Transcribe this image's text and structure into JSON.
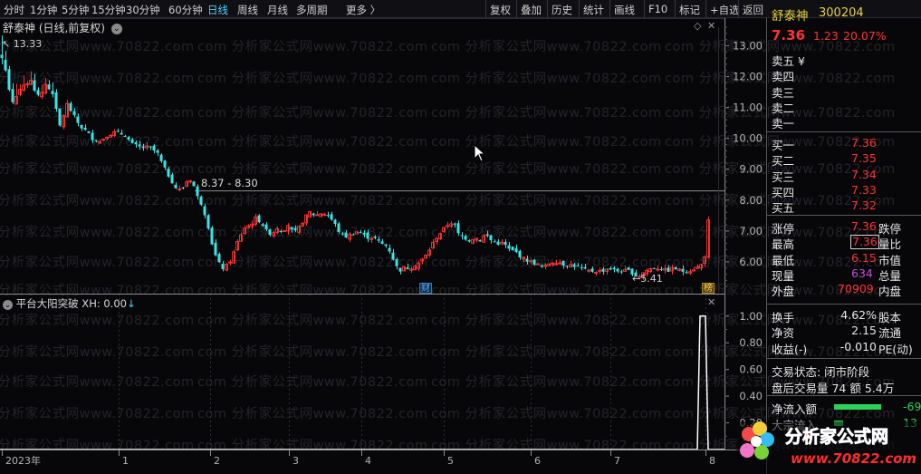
{
  "toolbar": {
    "periods": [
      "分时",
      "1分钟",
      "5分钟",
      "15分钟",
      "30分钟",
      "60分钟",
      "日线",
      "周线",
      "月线",
      "多周期",
      "更多 〉"
    ],
    "active_period": "日线",
    "actions": [
      "复权",
      "叠加",
      "历史",
      "统计",
      "画线",
      "F10",
      "标记",
      "+自选",
      "返回"
    ]
  },
  "main_chart": {
    "title": "舒泰神 (日线,前复权)",
    "max_label": "13.33",
    "range_label": "8.37 - 8.30",
    "min_label": "←5.41",
    "marker_cai": "财",
    "marker_bang": "榜",
    "watermark": "com 分析家公式网www.70822.com"
  },
  "indicator": {
    "title": "平台大阳突破  XH: 0.00",
    "arrow": "↓"
  },
  "chart_data": [
    {
      "type": "candlestick",
      "title": "舒泰神 (日线,前复权)",
      "yaxis_ticks": [
        13.0,
        12.0,
        11.0,
        10.0,
        9.0,
        8.0,
        7.0,
        6.0
      ],
      "xaxis_labels": [
        "2023年",
        "1",
        "2",
        "3",
        "4",
        "5",
        "6",
        "7",
        "8"
      ],
      "ylim": [
        5.0,
        13.6
      ],
      "high": 13.33,
      "low": 5.41,
      "last": 7.36,
      "close_path": [
        [
          0,
          12.7
        ],
        [
          4,
          12.5
        ],
        [
          10,
          11.6
        ],
        [
          14,
          11.2
        ],
        [
          22,
          11.6
        ],
        [
          34,
          11.9
        ],
        [
          40,
          11.3
        ],
        [
          50,
          11.7
        ],
        [
          58,
          11.4
        ],
        [
          66,
          10.4
        ],
        [
          74,
          11.1
        ],
        [
          82,
          10.7
        ],
        [
          88,
          10.4
        ],
        [
          96,
          10.2
        ],
        [
          102,
          10.0
        ],
        [
          110,
          9.9
        ],
        [
          118,
          10.1
        ],
        [
          128,
          10.2
        ],
        [
          138,
          10.1
        ],
        [
          146,
          9.8
        ],
        [
          156,
          9.7
        ],
        [
          166,
          9.7
        ],
        [
          174,
          9.5
        ],
        [
          180,
          9.1
        ],
        [
          188,
          8.7
        ],
        [
          194,
          8.4
        ],
        [
          200,
          8.3
        ],
        [
          206,
          8.6
        ],
        [
          212,
          8.7
        ],
        [
          216,
          8.2
        ],
        [
          222,
          7.9
        ],
        [
          228,
          7.4
        ],
        [
          234,
          6.6
        ],
        [
          240,
          6.0
        ],
        [
          246,
          5.8
        ],
        [
          252,
          5.9
        ],
        [
          258,
          6.3
        ],
        [
          264,
          6.8
        ],
        [
          270,
          7.1
        ],
        [
          276,
          7.2
        ],
        [
          282,
          7.4
        ],
        [
          288,
          7.3
        ],
        [
          294,
          7.0
        ],
        [
          300,
          6.9
        ],
        [
          306,
          7.1
        ],
        [
          312,
          7.0
        ],
        [
          318,
          7.2
        ],
        [
          324,
          6.9
        ],
        [
          330,
          7.1
        ],
        [
          336,
          7.4
        ],
        [
          342,
          7.6
        ],
        [
          348,
          7.5
        ],
        [
          356,
          7.6
        ],
        [
          362,
          7.5
        ],
        [
          368,
          7.3
        ],
        [
          374,
          7.0
        ],
        [
          380,
          6.8
        ],
        [
          388,
          6.9
        ],
        [
          396,
          7.0
        ],
        [
          404,
          6.8
        ],
        [
          412,
          6.8
        ],
        [
          420,
          6.6
        ],
        [
          428,
          6.5
        ],
        [
          434,
          6.1
        ],
        [
          440,
          5.7
        ],
        [
          446,
          5.8
        ],
        [
          452,
          5.8
        ],
        [
          458,
          5.9
        ],
        [
          464,
          6.0
        ],
        [
          470,
          6.2
        ],
        [
          476,
          6.5
        ],
        [
          482,
          6.8
        ],
        [
          488,
          7.0
        ],
        [
          494,
          7.2
        ],
        [
          500,
          7.3
        ],
        [
          506,
          6.9
        ],
        [
          512,
          6.8
        ],
        [
          518,
          6.7
        ],
        [
          524,
          6.8
        ],
        [
          530,
          6.7
        ],
        [
          536,
          6.9
        ],
        [
          542,
          6.7
        ],
        [
          548,
          6.6
        ],
        [
          556,
          6.6
        ],
        [
          562,
          6.4
        ],
        [
          570,
          6.3
        ],
        [
          578,
          6.1
        ],
        [
          586,
          6.0
        ],
        [
          594,
          5.9
        ],
        [
          600,
          5.8
        ],
        [
          608,
          6.0
        ],
        [
          616,
          6.0
        ],
        [
          624,
          5.9
        ],
        [
          632,
          5.9
        ],
        [
          640,
          5.8
        ],
        [
          648,
          5.7
        ],
        [
          656,
          5.7
        ],
        [
          664,
          5.7
        ],
        [
          672,
          5.8
        ],
        [
          680,
          5.7
        ],
        [
          688,
          5.7
        ],
        [
          696,
          5.7
        ],
        [
          704,
          5.5
        ],
        [
          712,
          5.7
        ],
        [
          720,
          5.8
        ],
        [
          728,
          5.8
        ],
        [
          736,
          5.7
        ],
        [
          744,
          5.8
        ],
        [
          752,
          5.7
        ],
        [
          760,
          5.7
        ],
        [
          768,
          5.8
        ],
        [
          774,
          5.9
        ],
        [
          778,
          6.2
        ],
        [
          782,
          7.36
        ]
      ]
    },
    {
      "type": "line",
      "title": "平台大阳突破",
      "series": [
        {
          "name": "XH",
          "values": [
            0,
            0,
            0,
            0,
            0,
            0,
            0,
            0,
            0,
            0,
            0,
            1,
            0
          ]
        }
      ],
      "yaxis_ticks": [
        1.0,
        0.8,
        0.6,
        0.4,
        0.2
      ],
      "ylim": [
        0,
        1.08
      ]
    }
  ],
  "stock": {
    "name": "舒泰神",
    "code": "300204",
    "price": "7.36",
    "change": "1.23",
    "change_pct": "20.07%",
    "sell_labels": [
      "卖五 ¥",
      "卖四",
      "卖三",
      "卖二",
      "卖一"
    ],
    "buy_labels": [
      "买一",
      "买二",
      "买三",
      "买四",
      "买五"
    ],
    "buy_prices": [
      "7.36",
      "7.35",
      "7.34",
      "7.33",
      "7.32"
    ]
  },
  "stats": [
    {
      "label": "涨停",
      "value": "7.36",
      "label2": "跌停"
    },
    {
      "label": "最高",
      "value": "7.36",
      "label2": "量比"
    },
    {
      "label": "最低",
      "value": "6.15",
      "label2": "市值"
    },
    {
      "label": "现量",
      "value": "634",
      "label2": "总量"
    },
    {
      "label": "外盘",
      "value": "70909",
      "label2": "内盘"
    }
  ],
  "stats2": [
    {
      "label": "换手",
      "value": "4.62%",
      "label2": "股本"
    },
    {
      "label": "净资",
      "value": "2.15",
      "label2": "流通"
    },
    {
      "label": "收益(-)",
      "value": "-0.010",
      "label2": "PE(动)"
    }
  ],
  "trade_status": "交易状态: 闭市阶段",
  "after_hours": "盘后交易量 74 额 5.4万",
  "flow": [
    {
      "label": "净流入额",
      "value": "-69"
    },
    {
      "label": "大宗流入",
      "value": "13"
    }
  ],
  "logo": {
    "text": "分析家公式网",
    "url": "www.70822.com"
  },
  "colors": {
    "up": "#ff3333",
    "down": "#39e6e6",
    "bg": "#070709",
    "name": "#e8d23c",
    "accent": "#4fd2ff",
    "purple": "#c24fd6",
    "green": "#2bd25a"
  }
}
